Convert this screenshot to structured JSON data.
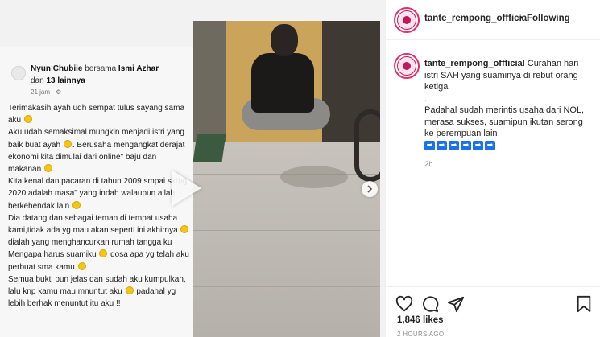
{
  "post": {
    "username": "tante_rempong_offficial",
    "follow_label": "Following",
    "separator": "•",
    "caption": {
      "username": "tante_rempong_offficial",
      "line1": "Curahan hari istri SAH yang suaminya di rebut orang ketiga",
      "line2": ".",
      "line3": "Padahal sudah merintis usaha dari NOL, merasa sukses, suamipun ikutan serong ke perempuan lain",
      "arrows": [
        "➡",
        "➡",
        "➡",
        "➡",
        "➡",
        "➡"
      ]
    },
    "caption_time": "2h",
    "likes": "1,846 likes",
    "date": "2 HOURS AGO"
  },
  "fb_post": {
    "author": "Nyun Chubiie",
    "with_word": "bersama",
    "tagged": "Ismi Azhar",
    "and_word": "dan",
    "others": "13 lainnya",
    "time": "21 jam · ⚙",
    "paragraphs": [
      "Terimakasih ayah udh sempat tulus sayang sama aku",
      "Aku udah semaksimal mungkin menjadi istri yang baik buat ayah",
      "Berusaha mengangkat derajat ekonomi kita dimulai dari online\" baju dan makanan",
      "Kita kenal dan pacaran di tahun 2009 smpai skrng 2020 adalah masa\" yang indah walaupun allah berkehendak lain",
      "Dia datang dan sebagai teman di tempat usaha kami,tidak ada yg mau akan seperti ini akhirnya",
      "dialah yang menghancurkan rumah tangga ku",
      "Mengapa harus suamiku",
      "dosa apa yg telah aku perbuat sma kamu",
      "Semua bukti pun jelas dan sudah aku kumpulkan, lalu knp kamu mau mnuntut aku",
      "padahal yg lebih berhak menuntut itu aku !!"
    ]
  },
  "icons": {
    "heart": "heart-icon",
    "comment": "comment-icon",
    "share": "share-icon",
    "save": "bookmark-icon",
    "next": "chevron-right-icon",
    "play": "play-icon"
  },
  "colors": {
    "emoji": "#f5c518",
    "arrow_blue": "#1a73e8",
    "avatar_ring": "#e1306c"
  }
}
